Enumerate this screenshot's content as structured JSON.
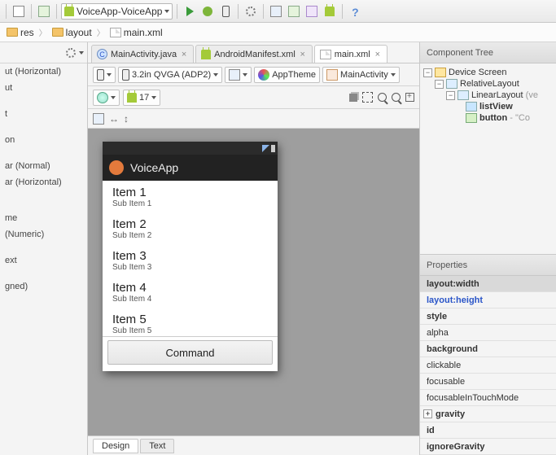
{
  "toolbar": {
    "run_config": "VoiceApp-VoiceApp"
  },
  "breadcrumb": {
    "c0": "res",
    "c1": "layout",
    "c2": "main.xml"
  },
  "palette": {
    "items": [
      "ut (Horizontal)",
      "ut",
      "",
      "t",
      "",
      "on",
      "",
      "ar (Normal)",
      "ar (Horizontal)",
      "",
      "",
      "me",
      "(Numeric)",
      "",
      "ext",
      "",
      "gned)"
    ]
  },
  "tabs": {
    "t0": "MainActivity.java",
    "t1": "AndroidManifest.xml",
    "t2": "main.xml"
  },
  "designer": {
    "device": "3.2in QVGA (ADP2)",
    "theme": "AppTheme",
    "activity": "MainActivity",
    "api": "17"
  },
  "phone": {
    "app_title": "VoiceApp",
    "items": [
      {
        "title": "Item 1",
        "sub": "Sub Item 1"
      },
      {
        "title": "Item 2",
        "sub": "Sub Item 2"
      },
      {
        "title": "Item 3",
        "sub": "Sub Item 3"
      },
      {
        "title": "Item 4",
        "sub": "Sub Item 4"
      },
      {
        "title": "Item 5",
        "sub": "Sub Item 5"
      }
    ],
    "button": "Command"
  },
  "bottom_tabs": {
    "design": "Design",
    "text": "Text"
  },
  "tree": {
    "title": "Component Tree",
    "n0": "Device Screen",
    "n1": "RelativeLayout",
    "n2": "LinearLayout",
    "n2_suffix": " (ve",
    "n3": "listView",
    "n4": "button",
    "n4_suffix": " - \"Co"
  },
  "props": {
    "title": "Properties",
    "p0": "layout:width",
    "p1": "layout:height",
    "p2": "style",
    "p3": "alpha",
    "p4": "background",
    "p5": "clickable",
    "p6": "focusable",
    "p7": "focusableInTouchMode",
    "p8": "gravity",
    "p9": "id",
    "p10": "ignoreGravity"
  }
}
